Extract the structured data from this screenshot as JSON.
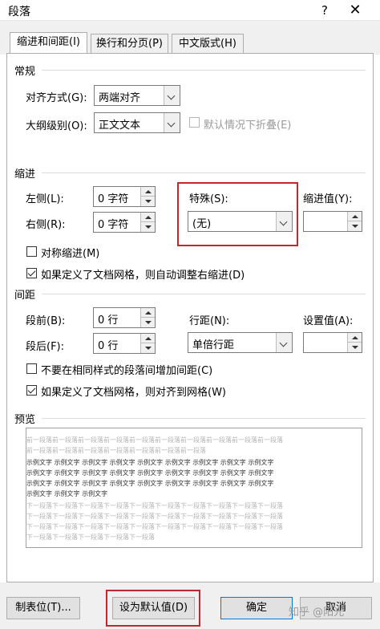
{
  "window": {
    "title": "段落",
    "help_label": "?",
    "close_label": "✕"
  },
  "tabs": [
    {
      "label": "缩进和间距(I)"
    },
    {
      "label": "换行和分页(P)"
    },
    {
      "label": "中文版式(H)"
    }
  ],
  "general": {
    "section_label": "常规",
    "alignment_label": "对齐方式(G):",
    "alignment_value": "两端对齐",
    "outline_label": "大纲级别(O):",
    "outline_value": "正文文本",
    "collapse_label": "默认情况下折叠(E)"
  },
  "indent": {
    "section_label": "缩进",
    "left_label": "左侧(L):",
    "left_value": "0 字符",
    "right_label": "右侧(R):",
    "right_value": "0 字符",
    "special_label": "特殊(S):",
    "special_value": "(无)",
    "indent_value_label": "缩进值(Y):",
    "indent_value": "",
    "mirror_label": "对称缩进(M)",
    "auto_adjust_label": "如果定义了文档网格，则自动调整右缩进(D)"
  },
  "spacing": {
    "section_label": "间距",
    "before_label": "段前(B):",
    "before_value": "0 行",
    "after_label": "段后(F):",
    "after_value": "0 行",
    "line_spacing_label": "行距(N):",
    "line_spacing_value": "单倍行距",
    "setting_label": "设置值(A):",
    "setting_value": "",
    "no_space_same_style_label": "不要在相同样式的段落间增加间距(C)",
    "snap_grid_label": "如果定义了文档网格，则对齐到网格(W)"
  },
  "preview": {
    "section_label": "预览",
    "lines": [
      "前一段落前一段落前一段落前一段落前一段落前一段落前一段落前一段落前一段落前一段落",
      "前一段落前一段落前一段落前一段落前一段落前一段落前一段落",
      "示例文字 示例文字 示例文字 示例文字 示例文字 示例文字 示例文字 示例文字 示例文字",
      "示例文字 示例文字 示例文字 示例文字 示例文字 示例文字 示例文字 示例文字 示例文字",
      "示例文字 示例文字 示例文字 示例文字 示例文字 示例文字 示例文字 示例文字 示例文字",
      "示例文字 示例文字 示例文字",
      "下一段落下一段落下一段落下一段落下一段落下一段落下一段落下一段落下一段落下一段落",
      "下一段落下一段落下一段落下一段落下一段落下一段落下一段落下一段落下一段落下一段落",
      "下一段落下一段落下一段落下一段落下一段落下一段落下一段落下一段落下一段落下一段落",
      "下一段落下一段落下一段落下一段落下一段落"
    ]
  },
  "footer": {
    "tabs_button": "制表位(T)...",
    "default_button": "设为默认值(D)",
    "ok_button": "确定",
    "cancel_button": "取消",
    "watermark": "知乎 @阳光"
  },
  "colors": {
    "highlight": "#c0282e",
    "primary_border": "#0078d7"
  }
}
